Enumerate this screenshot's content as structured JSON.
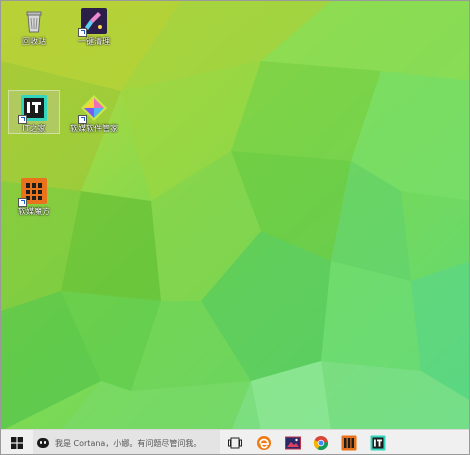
{
  "desktop": {
    "icons": [
      {
        "label": "回收站",
        "icon": "recycle-bin-icon"
      },
      {
        "label": "一键清理",
        "icon": "cleanup-broom-icon"
      },
      {
        "label": "IT之家",
        "icon": "ithome-icon"
      },
      {
        "label": "软媒软件管家",
        "icon": "software-manager-icon"
      },
      {
        "label": "软媒魔方",
        "icon": "ruanmei-mofang-icon"
      }
    ]
  },
  "taskbar": {
    "start_icon": "windows-logo-icon",
    "cortana_placeholder": "我是 Cortana，小娜。有问题尽管问我。",
    "items": [
      {
        "icon": "task-view-icon"
      },
      {
        "icon": "edge-browser-icon"
      },
      {
        "icon": "photo-app-icon"
      },
      {
        "icon": "chrome-browser-icon"
      },
      {
        "icon": "ruanmei-mofang-taskbar-icon"
      },
      {
        "icon": "ithome-taskbar-icon"
      }
    ]
  },
  "colors": {
    "wallpaper_primary": "#7ed957",
    "wallpaper_secondary": "#b9e63a",
    "ithome_teal": "#32d6bf",
    "mofang_orange": "#e8731c",
    "taskbar_bg": "#f0f0f0"
  }
}
